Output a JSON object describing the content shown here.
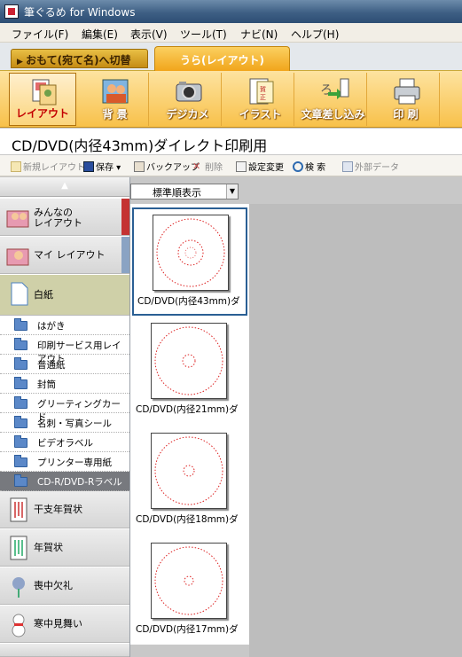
{
  "window": {
    "title": "筆ぐるめ for Windows"
  },
  "menu": [
    "ファイル(F)",
    "編集(E)",
    "表示(V)",
    "ツール(T)",
    "ナビ(N)",
    "ヘルプ(H)"
  ],
  "mode_tabs": {
    "front": "おもて(宛て名)へ切替",
    "back": "うら(レイアウト)"
  },
  "toolbar": [
    {
      "label": "レイアウト",
      "icon": "layout-icon",
      "active": true
    },
    {
      "label": "背 景",
      "icon": "background-icon"
    },
    {
      "label": "デジカメ",
      "icon": "camera-icon"
    },
    {
      "label": "イラスト",
      "icon": "illustration-icon"
    },
    {
      "label": "文章差し込み",
      "icon": "text-insert-icon"
    },
    {
      "label": "印 刷",
      "icon": "printer-icon"
    }
  ],
  "page_title": "CD/DVD(内径43mm)ダイレクト印刷用",
  "subtoolbar": [
    {
      "label": "新規レイアウト",
      "icon": "new-layout-icon",
      "disabled": true
    },
    {
      "label": "保存 ▾",
      "icon": "save-icon"
    },
    {
      "label": "バックアップ",
      "icon": "backup-icon"
    },
    {
      "label": "削除",
      "icon": "delete-icon",
      "disabled": true
    },
    {
      "label": "設定変更",
      "icon": "settings-icon"
    },
    {
      "label": "検 索",
      "icon": "search-icon"
    },
    {
      "label": "外部データ",
      "icon": "external-data-icon",
      "disabled": true
    }
  ],
  "sidebar": {
    "top_items": [
      {
        "label": "みんなの\nレイアウト",
        "bar_color": "#c43333"
      },
      {
        "label": "マイ レイアウト",
        "bar_color": "#8aa3c3"
      },
      {
        "label": "白紙",
        "selected": true
      }
    ],
    "folders": [
      {
        "label": "はがき"
      },
      {
        "label": "印刷サービス用レイアウト"
      },
      {
        "label": "普通紙"
      },
      {
        "label": "封筒"
      },
      {
        "label": "グリーティングカード"
      },
      {
        "label": "名刺・写真シール"
      },
      {
        "label": "ビデオラベル"
      },
      {
        "label": "プリンター専用紙"
      },
      {
        "label": "CD-R/DVD-Rラベル",
        "selected": true
      }
    ],
    "bottom_items": [
      {
        "label": "干支年賀状"
      },
      {
        "label": "年賀状"
      },
      {
        "label": "喪中欠礼"
      },
      {
        "label": "寒中見舞い"
      }
    ]
  },
  "sort": {
    "selected": "標準順表示"
  },
  "thumbnails": [
    {
      "caption": "CD/DVD(内径43mm)ダ",
      "inner_ratio": 0.36,
      "selected": true
    },
    {
      "caption": "CD/DVD(内径21mm)ダ",
      "inner_ratio": 0.18
    },
    {
      "caption": "CD/DVD(内径18mm)ダ",
      "inner_ratio": 0.16
    },
    {
      "caption": "CD/DVD(内径17mm)ダ",
      "inner_ratio": 0.15
    }
  ]
}
